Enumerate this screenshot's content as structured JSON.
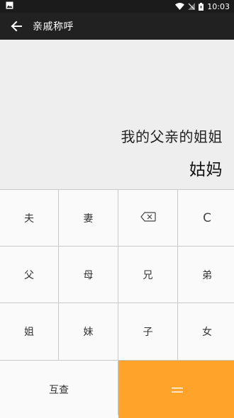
{
  "status_bar": {
    "time": "10:03",
    "icons": [
      "image-icon",
      "wifi-icon",
      "signal-off-icon",
      "battery-icon"
    ]
  },
  "app_bar": {
    "title": "亲戚称呼",
    "back_icon": "arrow-left-icon"
  },
  "display": {
    "expression": "我的父亲的姐姐",
    "result": "姑妈"
  },
  "keypad": {
    "row1": [
      "夫",
      "妻",
      "backspace",
      "C"
    ],
    "row2": [
      "父",
      "母",
      "兄",
      "弟"
    ],
    "row3": [
      "姐",
      "妹",
      "子",
      "女"
    ],
    "row4": [
      "互查",
      "＝"
    ]
  },
  "colors": {
    "status_bar_bg": "#1b1b1b",
    "app_bar_bg": "#212121",
    "display_bg": "#eeeeee",
    "key_bg": "#fafafa",
    "equals_bg": "#ffa32a"
  }
}
